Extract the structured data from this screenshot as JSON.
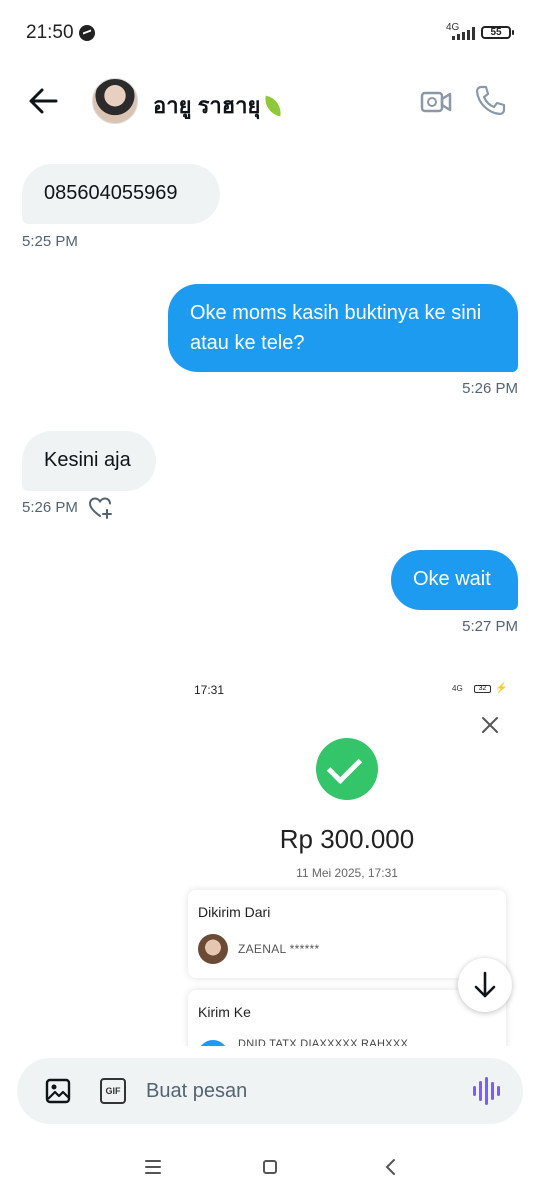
{
  "status_bar": {
    "time": "21:50",
    "network": "4G",
    "battery": "55"
  },
  "header": {
    "contact_name": "อายู ราฮายุ"
  },
  "messages": [
    {
      "direction": "in",
      "text": "085604055969",
      "time": "5:25 PM"
    },
    {
      "direction": "out",
      "text": "Oke moms kasih buktinya ke sini atau ke tele?",
      "time": "5:26 PM"
    },
    {
      "direction": "in",
      "text": "Kesini aja",
      "time": "5:26 PM"
    },
    {
      "direction": "out",
      "text": "Oke wait",
      "time": "5:27 PM"
    }
  ],
  "attachment": {
    "status_time": "17:31",
    "status_network": "4G",
    "status_battery": "32",
    "amount": "Rp 300.000",
    "date": "11 Mei 2025, 17:31",
    "from_title": "Dikirim Dari",
    "sender_name": "ZAENAL ******",
    "to_title": "Kirim Ke",
    "recipient_name": "DNID TATX DIAXXXXX RAHXXX"
  },
  "composer": {
    "placeholder": "Buat pesan",
    "gif_label": "GIF"
  },
  "colors": {
    "outgoing_bubble": "#1d9bf0",
    "incoming_bubble": "#eff3f4",
    "success_green": "#34c46a",
    "voice_accent": "#7b5cff"
  }
}
